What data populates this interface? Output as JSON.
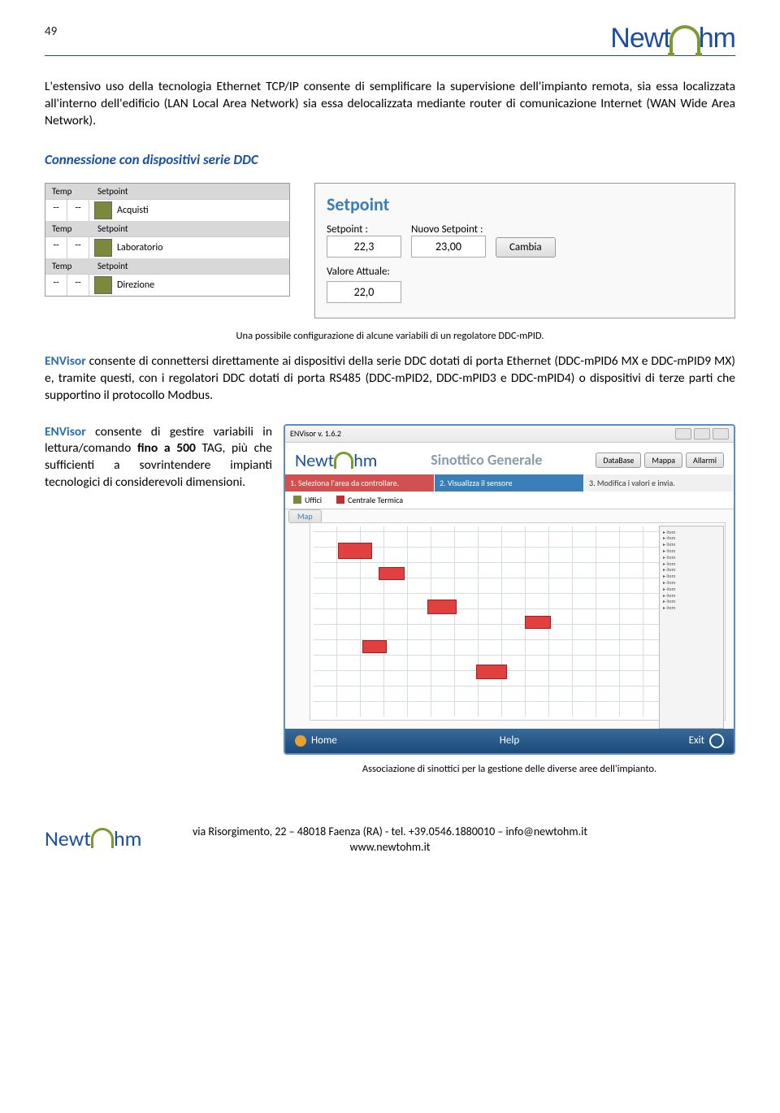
{
  "header": {
    "page_number": "49",
    "brand_left": "Newt",
    "brand_right": "hm"
  },
  "para1": "L'estensivo uso della tecnologia Ethernet TCP/IP consente di semplificare la supervisione dell'impianto remota, sia essa localizzata all'interno dell'edificio (LAN Local Area Network) sia essa delocalizzata mediante router di comunicazione Internet (WAN Wide Area Network).",
  "section_title": "Connessione con dispositivi serie DDC",
  "var_table": {
    "col_temp": "Temp",
    "col_setpoint": "Setpoint",
    "dash": "--",
    "rows": [
      "Acquisti",
      "Laboratorio",
      "Direzione"
    ]
  },
  "setpoint_panel": {
    "title": "Setpoint",
    "label_sp": "Setpoint :",
    "label_new": "Nuovo Setpoint :",
    "val_sp": "22,3",
    "val_new": "23,00",
    "btn": "Cambia",
    "label_actual": "Valore Attuale:",
    "val_actual": "22,0"
  },
  "caption1": "Una possibile configurazione di alcune variabili di un regolatore DDC-mPID.",
  "para2a": "ENVisor",
  "para2b": " consente di connettersi direttamente ai dispositivi della serie DDC dotati di porta Ethernet (DDC-mPID6 MX e DDC-mPID9 MX) e, tramite questi, con i regolatori DDC dotati di porta RS485 (DDC-mPID2, DDC-mPID3 e DDC-mPID4) o dispositivi di terze parti che supportino il protocollo Modbus.",
  "para3a": "ENVisor",
  "para3b": " consente di gestire variabili in lettura/comando ",
  "para3c": "fino a 500",
  "para3d": " TAG, più che sufficienti a sovrintendere impianti tecnologici di considerevoli dimensioni.",
  "app": {
    "titlebar": "ENVisor v. 1.6.2",
    "sinottico": "Sinottico Generale",
    "btn_db": "DataBase",
    "btn_map": "Mappa",
    "btn_alarm": "Allarmi",
    "step1": "1. Seleziona l'area da controllare.",
    "step2": "2. Visualizza il sensore",
    "step3": "3. Modifica i valori e invia.",
    "area1": "Uffici",
    "area2": "Centrale Termica",
    "map_tab": "Map",
    "bb_home": "Home",
    "bb_help": "Help",
    "bb_exit": "Exit"
  },
  "caption2": "Associazione di sinottici per la gestione delle diverse aree dell'impianto.",
  "footer": {
    "line1": "via Risorgimento, 22 – 48018 Faenza (RA) - tel. +39.0546.1880010 – info@newtohm.it",
    "line2": "www.newtohm.it"
  }
}
